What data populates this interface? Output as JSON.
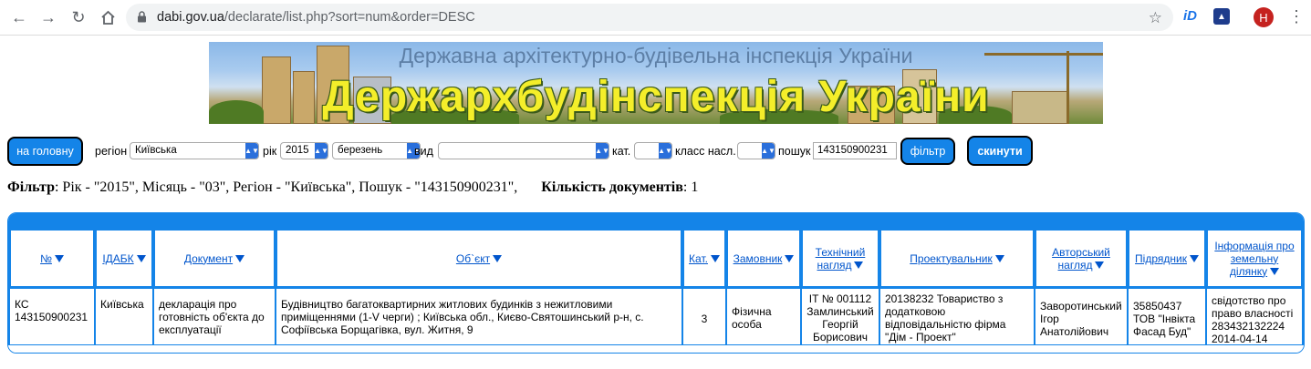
{
  "browser": {
    "url_host": "dabi.gov.ua",
    "url_path": "/declarate/list.php?sort=num&order=DESC",
    "avatar_letter": "H",
    "ext1_label": "iD"
  },
  "banner": {
    "subtitle": "Державна архітектурно-будівельна інспекція України",
    "title": "Держархбудінспекція України"
  },
  "filters": {
    "home_button": "на головну",
    "region_label": "регіон",
    "region_value": "Київська",
    "year_label": "рік",
    "year_value": "2015",
    "month_value": "березень",
    "type_label": "вид",
    "type_value": "",
    "cat_label": "кат.",
    "cat_value": "",
    "class_label": "класс насл.",
    "class_value": "",
    "search_label": "пошук",
    "search_value": "143150900231",
    "filter_button": "фільтр",
    "reset_button": "скинути"
  },
  "summary": {
    "filter_label": "Фільтр",
    "filter_text": ": Рік - \"2015\", Місяць - \"03\", Регіон - \"Київська\", Пошук - \"143150900231\",",
    "count_label": "Кількість документів",
    "count_value": ": 1"
  },
  "table": {
    "headers": [
      "№",
      "ІДАБК",
      "Документ",
      "Об`єкт",
      "Кат.",
      "Замовник",
      "Технічний нагляд",
      "Проектувальник",
      "Авторський нагляд",
      "Підрядник",
      "Інформація про земельну ділянку"
    ],
    "row": {
      "num": "КС 143150900231",
      "idabk": "Київська",
      "document": "декларація про готовність об'єкта до експлуатації",
      "object": "Будівництво багатоквартирних житлових будинків з нежитловими приміщеннями (1-V черги) ; Київська обл., Києво-Святошинський р-н, с. Софіївська Борщагівка, вул. Житня, 9",
      "category": "3",
      "customer": "Фізична особа",
      "tech_supervision": "ІТ № 001112 Замлинський Георгій Борисович",
      "designer": "20138232 Товариство з додатковою відповідальністю фірма \"Дім - Проект\"",
      "author_supervision": "Заворотинський Ігор Анатолійович",
      "contractor": "35850437 ТОВ \"Інвікта Фасад Буд\"",
      "land_info": "свідотство про право власності 283432132224 2014-04-14"
    }
  }
}
